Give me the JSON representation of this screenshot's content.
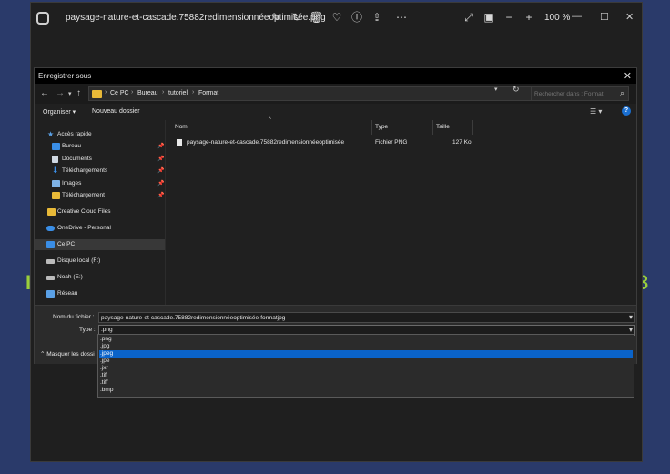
{
  "viewer": {
    "filename": "paysage-nature-et-cascade.75882redimensionnéeoptimisée.png",
    "zoom": "100 %"
  },
  "background": {
    "left_text": "I",
    "right_text": "3"
  },
  "dialog": {
    "title": "Enregistrer sous",
    "close": "✕",
    "breadcrumb": [
      "Ce PC",
      "Bureau",
      "tutoriel",
      "Format"
    ],
    "search_placeholder": "Rechercher dans : Format",
    "toolbar": {
      "organize": "Organiser ▾",
      "new_folder": "Nouveau dossier"
    },
    "sidebar": [
      {
        "label": "Accès rapide",
        "icon": "star-icon",
        "color": "#5aa0e6"
      },
      {
        "label": "Bureau",
        "icon": "desktop-icon",
        "color": "#3a8ee6",
        "pinned": true
      },
      {
        "label": "Documents",
        "icon": "documents-icon",
        "color": "#cfd8e3",
        "pinned": true
      },
      {
        "label": "Téléchargements",
        "icon": "download-icon",
        "color": "#3a8ee6",
        "pinned": true
      },
      {
        "label": "Images",
        "icon": "images-icon",
        "color": "#7fb3e6",
        "pinned": true
      },
      {
        "label": "Téléchargement",
        "icon": "folder-icon",
        "color": "#e8b938",
        "pinned": true
      },
      {
        "label": "Creative Cloud Files",
        "icon": "creative-cloud-icon",
        "color": "#e8b938"
      },
      {
        "label": "OneDrive - Personal",
        "icon": "onedrive-icon",
        "color": "#3a8ee6"
      },
      {
        "label": "Ce PC",
        "icon": "computer-icon",
        "color": "#3a8ee6",
        "selected": true
      },
      {
        "label": "Disque local (F:)",
        "icon": "drive-icon",
        "color": "#bbbbbb"
      },
      {
        "label": "Noah (E:)",
        "icon": "drive-icon",
        "color": "#bbbbbb"
      },
      {
        "label": "Réseau",
        "icon": "network-icon",
        "color": "#5aa0e6"
      }
    ],
    "columns": {
      "name": "Nom",
      "type": "Type",
      "size": "Taille"
    },
    "files": [
      {
        "name": "paysage-nature-et-cascade.75882redimensionnéeoptimisée",
        "type": "Fichier PNG",
        "size": "127 Ko"
      }
    ],
    "filename_label": "Nom du fichier :",
    "filename_value": "paysage-nature-et-cascade.75882redimensionnéeoptimisée-formatjpg",
    "type_label": "Type :",
    "type_value": ".png",
    "hide_folders": "Masquer les dossi",
    "type_options": [
      ".png",
      ".jpg",
      ".jpeg",
      ".jpe",
      ".jxr",
      ".tif",
      ".tiff",
      ".bmp"
    ],
    "type_selected_index": 2
  }
}
